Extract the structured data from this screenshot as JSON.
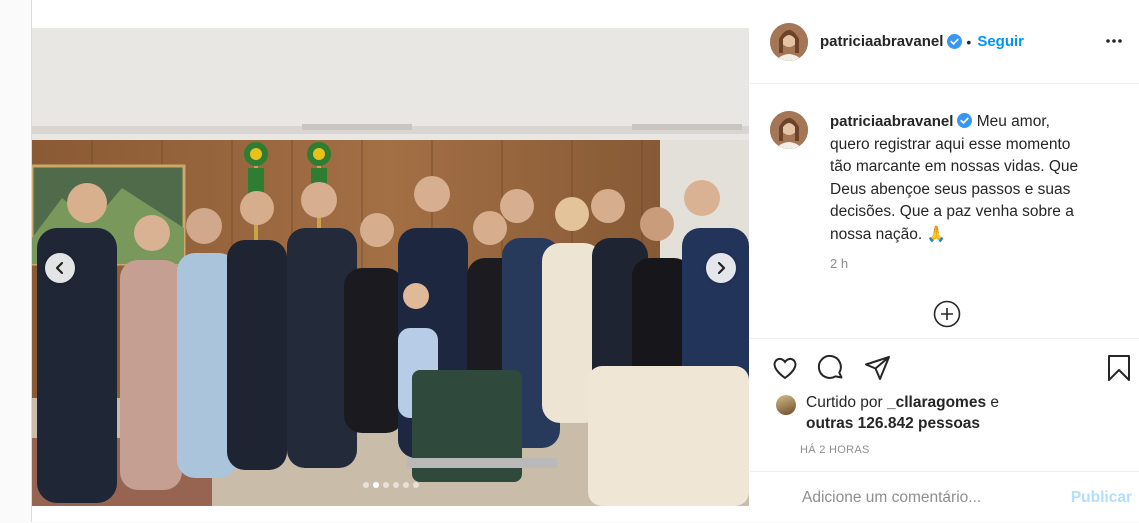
{
  "post": {
    "username": "patriciaabravanel",
    "follow_label": "Seguir",
    "bullet": "•",
    "caption": "Meu amor, quero registrar aqui esse momento tão marcante em nossas vidas. Que Deus abençoe seus passos e suas decisões. Que a paz venha sobre a nossa nação. 🙏",
    "caption_time": "2 h",
    "likes": {
      "prefix": "Curtido por",
      "user": "_cllaragomes",
      "connector": "e",
      "others": "outras 126.842 pessoas"
    },
    "timestamp": "HÁ 2 HORAS",
    "comment": {
      "placeholder": "Adicione um comentário...",
      "post_label": "Publicar"
    }
  },
  "carousel": {
    "slides": 6,
    "active_index": 1
  },
  "colors": {
    "accent": "#0095f6",
    "verified": "#3897f0",
    "muted": "#8e8e8e",
    "publish_disabled": "#b2dffc"
  },
  "icons": [
    "verified-badge-icon",
    "more-options-icon",
    "load-more-comments-icon",
    "heart-icon",
    "comment-icon",
    "share-icon",
    "bookmark-icon",
    "carousel-prev-icon",
    "carousel-next-icon"
  ]
}
